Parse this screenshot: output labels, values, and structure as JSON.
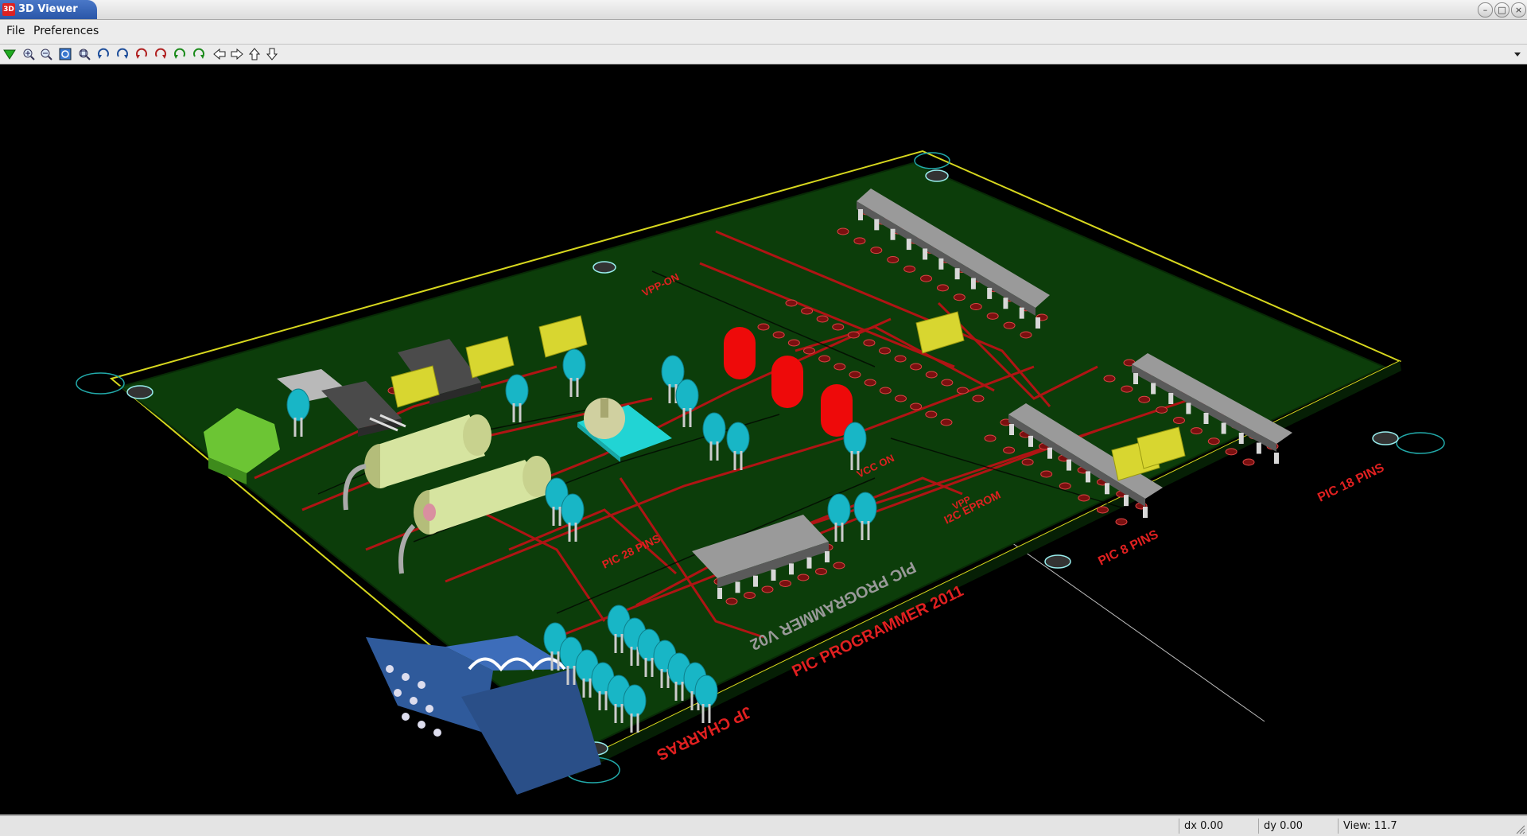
{
  "window": {
    "title": "3D Viewer",
    "app_icon_text": "3D"
  },
  "menu": [
    {
      "label": "File"
    },
    {
      "label": "Preferences"
    }
  ],
  "toolbar": {
    "icons": [
      "reload-icon",
      "zoom-in-icon",
      "zoom-out-icon",
      "zoom-redraw-icon",
      "zoom-fit-icon",
      "rotate-x-neg-icon",
      "rotate-x-pos-icon",
      "rotate-y-neg-icon",
      "rotate-y-pos-icon",
      "rotate-z-neg-icon",
      "rotate-z-pos-icon",
      "move-left-icon",
      "move-right-icon",
      "move-up-icon",
      "move-down-icon"
    ]
  },
  "board": {
    "silkscreen": [
      "PIC PROGRAMMER 2011",
      "PIC PROGRAMMER V02",
      "JP CHARRAS",
      "PIC 8 PINS",
      "PIC 18 PINS",
      "PIC 28 PINS",
      "I2C EPROM",
      "VPP-ON",
      "VCC ON",
      "VPP"
    ]
  },
  "colors": {
    "board": "#0c3d0a",
    "trace": "#b01414",
    "silk": "#e02020",
    "outline": "#d7d71e",
    "viewport_bg": "#000000"
  },
  "status": {
    "dx": "dx 0.00",
    "dy": "dy 0.00",
    "view": "View: 11.7"
  }
}
